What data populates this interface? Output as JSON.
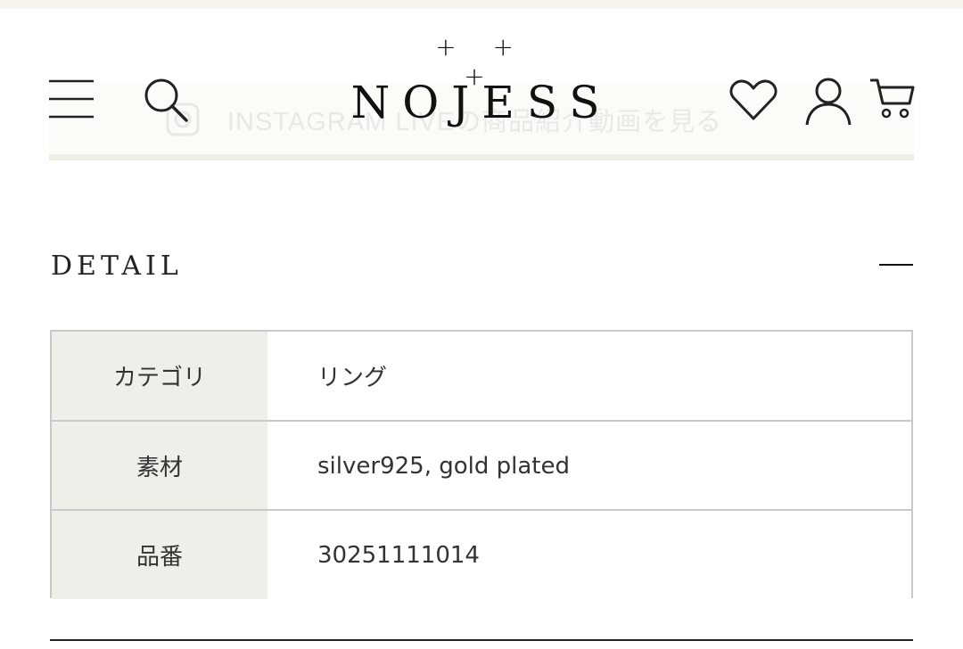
{
  "header": {
    "logo_crosses": "+ + +",
    "logo": "NOJESS",
    "icons": [
      "menu-icon",
      "search-icon",
      "heart-icon",
      "user-icon",
      "cart-icon"
    ]
  },
  "banner": {
    "text": "INSTAGRAM LIVEの商品紹介動画を見る"
  },
  "detail": {
    "title": "DETAIL",
    "rows": [
      {
        "label": "カテゴリ",
        "value": "リング"
      },
      {
        "label": "素材",
        "value": "silver925, gold plated"
      },
      {
        "label": "品番",
        "value": "30251111014"
      }
    ]
  },
  "colors": {
    "label_bg": "#efefea",
    "border": "#c9c9c9",
    "text": "#222222"
  }
}
